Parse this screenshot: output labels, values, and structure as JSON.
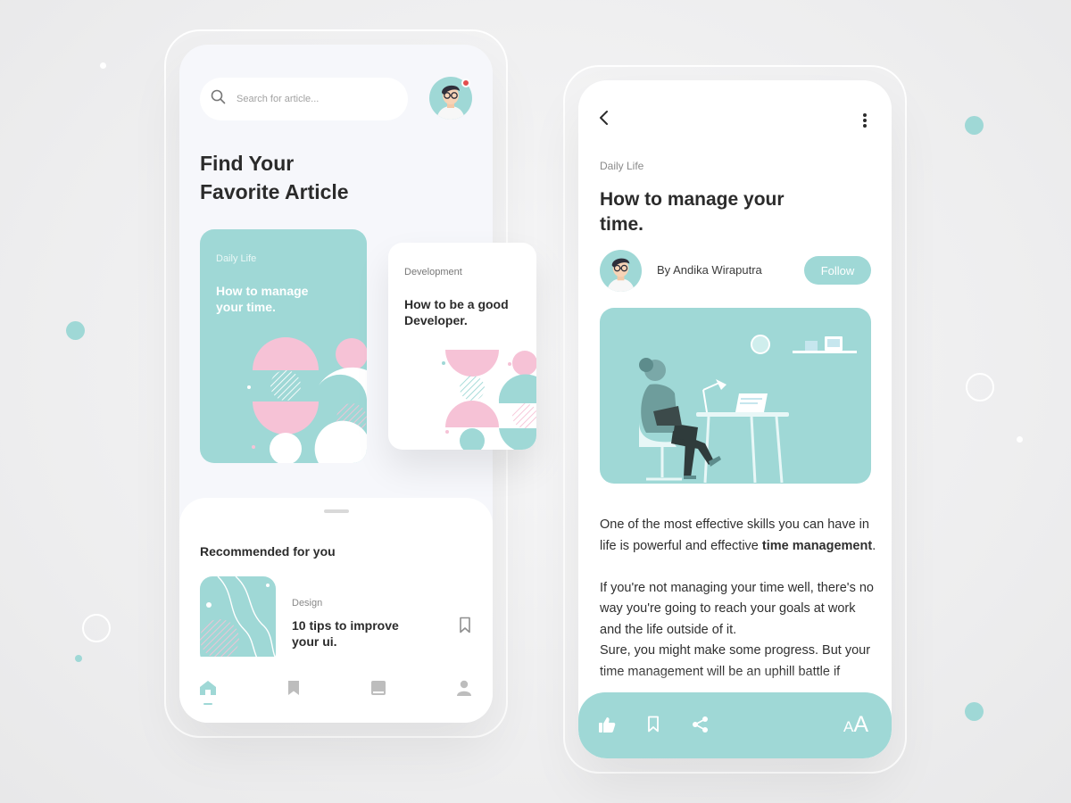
{
  "colors": {
    "accent": "#9fd8d6",
    "pink": "#f6c2d6",
    "text": "#2b2b2b",
    "notification": "#e24e4e"
  },
  "home": {
    "search": {
      "placeholder": "Search for article...",
      "icon": "search-icon"
    },
    "heading": "Find Your\nFavorite Article",
    "featured": [
      {
        "category": "Daily Life",
        "title": "How to manage\nyour time."
      },
      {
        "category": "Development",
        "title": "How to be a good\nDeveloper."
      }
    ],
    "recommended": {
      "section_title": "Recommended for you",
      "items": [
        {
          "category": "Design",
          "title": "10 tips to improve\nyour ui."
        }
      ]
    },
    "tabs": [
      {
        "name": "home",
        "icon": "home-icon",
        "active": true
      },
      {
        "name": "saved",
        "icon": "bookmark-icon",
        "active": false
      },
      {
        "name": "library",
        "icon": "book-icon",
        "active": false
      },
      {
        "name": "profile",
        "icon": "user-icon",
        "active": false
      }
    ]
  },
  "article": {
    "category": "Daily Life",
    "title": "How to manage your\ntime.",
    "author": "By Andika Wiraputra",
    "follow_label": "Follow",
    "p1_before": "One of the most effective skills you can have in life is powerful and effective ",
    "p1_bold": "time management",
    "p1_after": ".",
    "p2": "If you're not managing your time well, there's no way you're going to reach your goals at work and the life outside of it.",
    "p3": "Sure, you might make some progress. But your time management will be an uphill battle if",
    "actions": [
      "like-icon",
      "bookmark-icon",
      "share-icon"
    ],
    "font_control_small": "A",
    "font_control_big": "A"
  }
}
